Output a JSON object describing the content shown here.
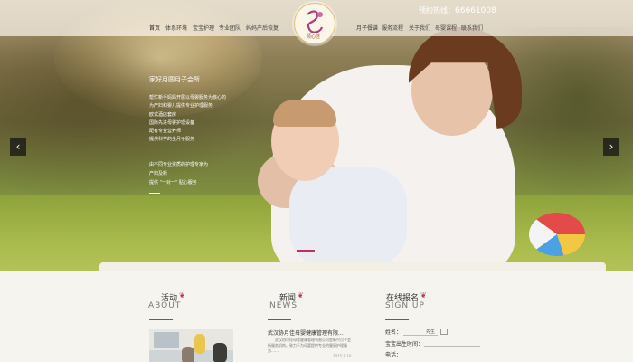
{
  "header": {
    "nav_left": [
      "首页",
      "体系环境",
      "宝宝护理",
      "专业团队",
      "妈妈产后恢复"
    ],
    "nav_right": [
      "月子餐谱",
      "服务流程",
      "关于我们",
      "母婴课程",
      "联系我们"
    ],
    "active_item": "首页",
    "hotline_label": "预约热线：",
    "hotline_number": "66661008",
    "logo_text": "倾心佳"
  },
  "hero": {
    "slogan": "家好月圆月子会所",
    "bullets": [
      "帮忙新手妈妈开展以母婴服务为核心的",
      "为产妇和婴儿提供专业护理服务",
      "欧式酒店套房",
      "国际先进母婴护理设备",
      "配有专业营养师",
      "提供科学的坐月子服务"
    ],
    "bullets2": [
      "由不同专业资质的护理专家为",
      "产妇及新",
      "提供 \"一对一\" 贴心服务"
    ],
    "prev_icon": "chevron-left-icon",
    "next_icon": "chevron-right-icon",
    "accent_color": "#c0305a"
  },
  "sections": {
    "about": {
      "title": "活动",
      "title_en": "ABOUT"
    },
    "news": {
      "title": "新闻",
      "title_en": "NEWS",
      "headline": "武汉协月佳母婴健康管理有限...",
      "summary": "武汉协月佳母婴健康管理有限公司是新兴月子会所服务机构，致力于为母婴提供专业的健康护理服务……",
      "date": "2015.8.10"
    },
    "signup": {
      "title": "在线报名",
      "title_en": "SIGN UP",
      "name_label": "姓名：",
      "gender_option": "先生",
      "birth_label": "宝宝出生时间：",
      "phone_label": "电话："
    }
  }
}
